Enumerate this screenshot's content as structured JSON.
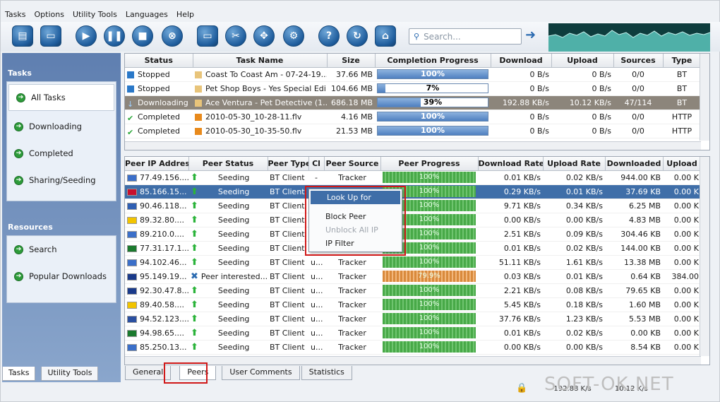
{
  "menu": [
    "Tasks",
    "Options",
    "Utility Tools",
    "Languages",
    "Help"
  ],
  "toolbar": {
    "search_placeholder": "Search..."
  },
  "sidebar": {
    "tasks_header": "Tasks",
    "task_items": [
      "All Tasks",
      "Downloading",
      "Completed",
      "Sharing/Seeding"
    ],
    "resources_header": "Resources",
    "resource_items": [
      "Search",
      "Popular Downloads"
    ],
    "tabs": [
      "Tasks",
      "Utility Tools"
    ]
  },
  "tasks_table": {
    "columns": [
      "Status",
      "Task Name",
      "Size",
      "Completion Progress",
      "Download",
      "Upload",
      "Sources",
      "Type"
    ],
    "rows": [
      {
        "status": "Stopped",
        "name": "Coast To Coast Am - 07-24-19...",
        "size": "37.66 MB",
        "progress": "100%",
        "pct": 100,
        "download": "0 B/s",
        "upload": "0 B/s",
        "sources": "0/0",
        "type": "BT"
      },
      {
        "status": "Stopped",
        "name": "Pet Shop Boys - Yes Special Edi...",
        "size": "104.66 MB",
        "progress": "7%",
        "pct": 7,
        "download": "0 B/s",
        "upload": "0 B/s",
        "sources": "0/0",
        "type": "BT"
      },
      {
        "status": "Downloading",
        "name": "Ace Ventura - Pet Detective (1...",
        "size": "686.18 MB",
        "progress": "39%",
        "pct": 39,
        "download": "192.88 KB/s",
        "upload": "10.12 KB/s",
        "sources": "47/114",
        "type": "BT"
      },
      {
        "status": "Completed",
        "name": "2010-05-30_10-28-11.flv",
        "size": "4.16 MB",
        "progress": "100%",
        "pct": 100,
        "download": "0 B/s",
        "upload": "0 B/s",
        "sources": "0/0",
        "type": "HTTP"
      },
      {
        "status": "Completed",
        "name": "2010-05-30_10-35-50.flv",
        "size": "21.53 MB",
        "progress": "100%",
        "pct": 100,
        "download": "0 B/s",
        "upload": "0 B/s",
        "sources": "0/0",
        "type": "HTTP"
      }
    ]
  },
  "peers_table": {
    "columns": [
      "Peer IP Address",
      "Peer Status",
      "Peer Type",
      "Cl",
      "Peer Source",
      "Peer Progress",
      "Download Rate",
      "Upload Rate",
      "Downloaded",
      "Upload"
    ],
    "rows": [
      {
        "ip": "77.49.156....",
        "status": "Seeding",
        "type": "BT Client",
        "cl": "-",
        "source": "Tracker",
        "progress": "100%",
        "dl": "0.01 KB/s",
        "ul": "0.02 KB/s",
        "downloaded": "944.00 KB",
        "uploaded": "0.00 K"
      },
      {
        "ip": "85.166.15...",
        "status": "Seeding",
        "type": "BT Client",
        "cl": "",
        "source": "",
        "progress": "100%",
        "dl": "0.29 KB/s",
        "ul": "0.01 KB/s",
        "downloaded": "37.69 KB",
        "uploaded": "0.00 K"
      },
      {
        "ip": "90.46.118...",
        "status": "Seeding",
        "type": "BT Client",
        "cl": "",
        "source": "",
        "progress": "100%",
        "dl": "9.71 KB/s",
        "ul": "0.34 KB/s",
        "downloaded": "6.25 MB",
        "uploaded": "0.00 K"
      },
      {
        "ip": "89.32.80....",
        "status": "Seeding",
        "type": "BT Client",
        "cl": "",
        "source": "",
        "progress": "100%",
        "dl": "0.00 KB/s",
        "ul": "0.00 KB/s",
        "downloaded": "4.83 MB",
        "uploaded": "0.00 K"
      },
      {
        "ip": "89.210.0....",
        "status": "Seeding",
        "type": "BT Client",
        "cl": "",
        "source": "",
        "progress": "100%",
        "dl": "2.51 KB/s",
        "ul": "0.09 KB/s",
        "downloaded": "304.46 KB",
        "uploaded": "0.00 K"
      },
      {
        "ip": "77.31.17.1...",
        "status": "Seeding",
        "type": "BT Client",
        "cl": "",
        "source": "",
        "progress": "100%",
        "dl": "0.01 KB/s",
        "ul": "0.02 KB/s",
        "downloaded": "144.00 KB",
        "uploaded": "0.00 K"
      },
      {
        "ip": "94.102.46...",
        "status": "Seeding",
        "type": "BT Client",
        "cl": "u...",
        "source": "Tracker",
        "progress": "100%",
        "dl": "51.11 KB/s",
        "ul": "1.61 KB/s",
        "downloaded": "13.38 MB",
        "uploaded": "0.00 K"
      },
      {
        "ip": "95.149.19...",
        "status": "Peer interested...",
        "type": "BT Client",
        "cl": "u...",
        "source": "Tracker",
        "progress": "79.9%",
        "dl": "0.03 KB/s",
        "ul": "0.01 KB/s",
        "downloaded": "0.64 KB",
        "uploaded": "384.00"
      },
      {
        "ip": "92.30.47.8...",
        "status": "Seeding",
        "type": "BT Client",
        "cl": "u...",
        "source": "Tracker",
        "progress": "100%",
        "dl": "2.21 KB/s",
        "ul": "0.08 KB/s",
        "downloaded": "79.65 KB",
        "uploaded": "0.00 K"
      },
      {
        "ip": "89.40.58....",
        "status": "Seeding",
        "type": "BT Client",
        "cl": "u...",
        "source": "Tracker",
        "progress": "100%",
        "dl": "5.45 KB/s",
        "ul": "0.18 KB/s",
        "downloaded": "1.60 MB",
        "uploaded": "0.00 K"
      },
      {
        "ip": "94.52.123....",
        "status": "Seeding",
        "type": "BT Client",
        "cl": "u...",
        "source": "Tracker",
        "progress": "100%",
        "dl": "37.76 KB/s",
        "ul": "1.23 KB/s",
        "downloaded": "5.53 MB",
        "uploaded": "0.00 K"
      },
      {
        "ip": "94.98.65....",
        "status": "Seeding",
        "type": "BT Client",
        "cl": "u...",
        "source": "Tracker",
        "progress": "100%",
        "dl": "0.01 KB/s",
        "ul": "0.02 KB/s",
        "downloaded": "0.00 KB",
        "uploaded": "0.00 K"
      },
      {
        "ip": "85.250.13...",
        "status": "Seeding",
        "type": "BT Client",
        "cl": "u...",
        "source": "Tracker",
        "progress": "100%",
        "dl": "0.00 KB/s",
        "ul": "0.00 KB/s",
        "downloaded": "8.54 KB",
        "uploaded": "0.00 K"
      }
    ]
  },
  "context_menu": {
    "items": [
      "Look Up for Location",
      "Block Peer",
      "Unblock All IP",
      "IP Filter"
    ]
  },
  "bottom_tabs": [
    "General",
    "Peers",
    "User Comments",
    "Statistics"
  ],
  "statusbar": {
    "down": "192.88 K/s",
    "up": "10.12 K/s"
  },
  "watermark": "SOFT-OK.NET",
  "colors": {
    "selection": "#3f6ea8",
    "highlight_box": "#d01818",
    "sidebar": "#6f8fbd"
  }
}
